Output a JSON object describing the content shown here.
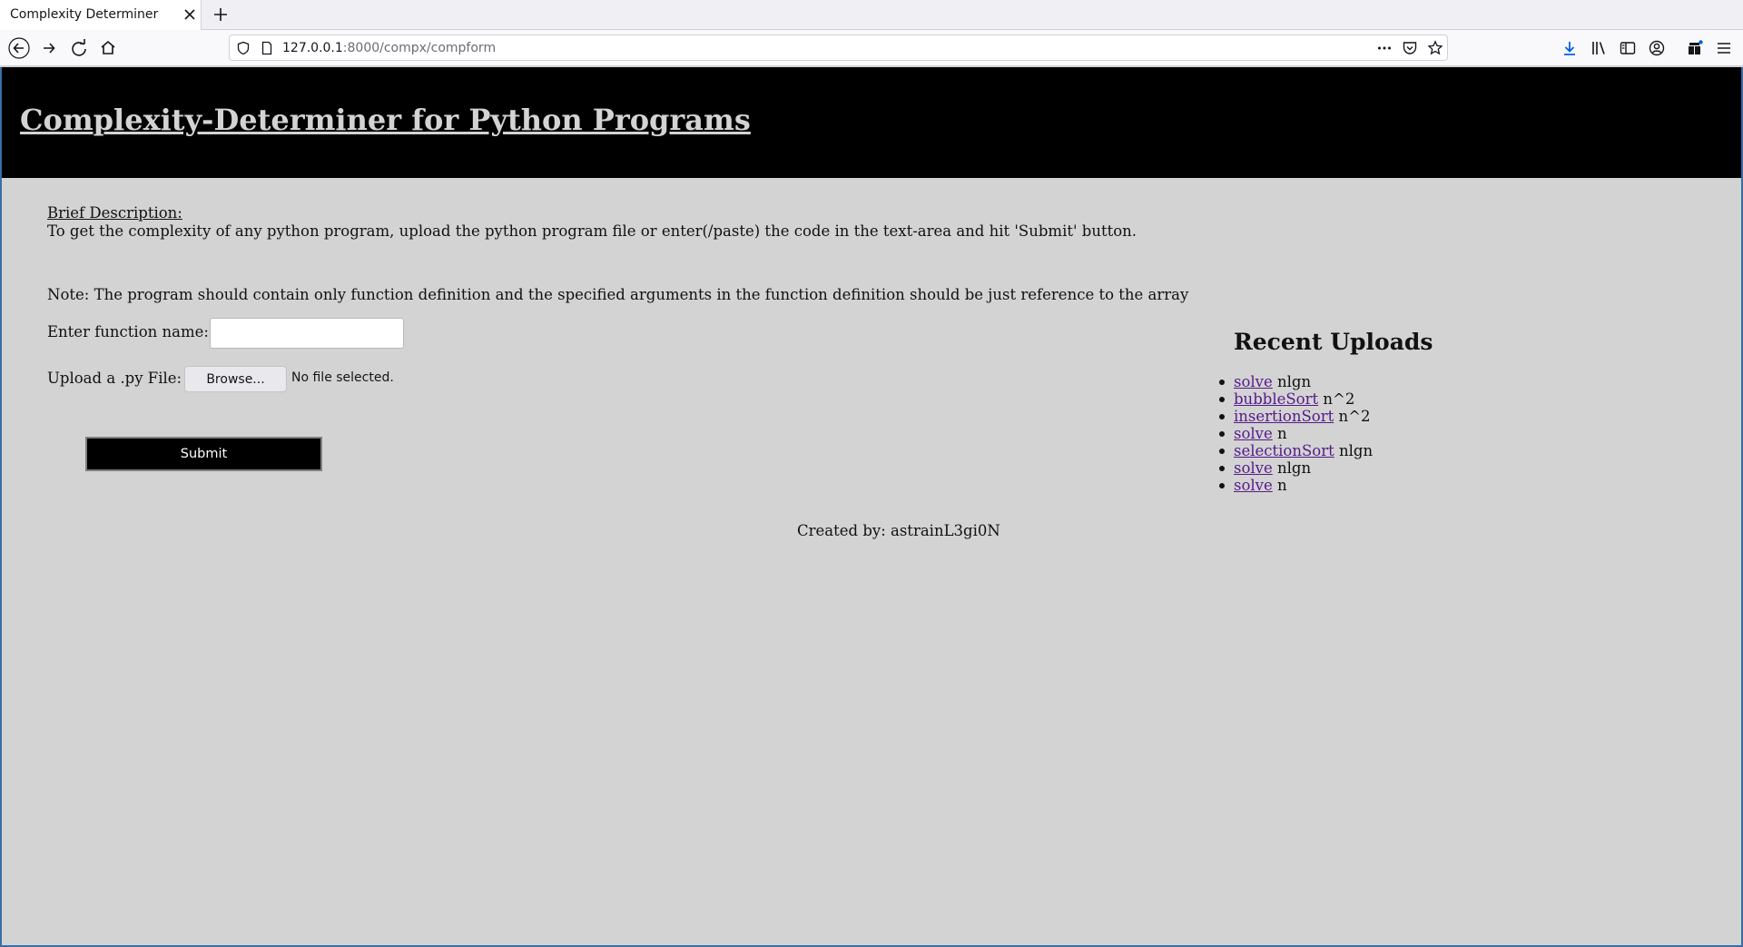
{
  "browser": {
    "tab_title": "Complexity Determiner",
    "url_host": "127.0.0.1",
    "url_rest": ":8000/compx/compform"
  },
  "header": {
    "title": "Complexity-Determiner for Python Programs"
  },
  "description": {
    "heading": "Brief Description:",
    "text": "To get the complexity of any python program, upload the python program file or enter(/paste) the code in the text-area and hit 'Submit' button.",
    "note": "Note: The program should contain only function definition and the specified arguments in the function definition should be just reference to the array"
  },
  "form": {
    "function_label": "Enter function name:",
    "function_value": "",
    "upload_label": "Upload a .py File:",
    "browse_label": "Browse...",
    "no_file_text": "No file selected.",
    "submit_label": "Submit"
  },
  "recent_uploads": {
    "title": "Recent Uploads",
    "items": [
      {
        "name": "solve",
        "complexity": "nlgn"
      },
      {
        "name": "bubbleSort",
        "complexity": "n^2"
      },
      {
        "name": "insertionSort",
        "complexity": "n^2"
      },
      {
        "name": "solve",
        "complexity": "n"
      },
      {
        "name": "selectionSort",
        "complexity": "nlgn"
      },
      {
        "name": "solve",
        "complexity": "nlgn"
      },
      {
        "name": "solve",
        "complexity": "n"
      }
    ]
  },
  "footer": {
    "text": "Created by: astrainL3gi0N"
  },
  "colors": {
    "header_bg": "#000000",
    "page_bg": "#d3d3d3",
    "visited_link": "#551a8b",
    "download_accent": "#0060df"
  },
  "icons": {
    "tab_close": "close-icon",
    "new_tab": "plus-icon",
    "back": "back-arrow-icon",
    "forward": "forward-arrow-icon",
    "reload": "reload-icon",
    "home": "home-icon",
    "shield": "shield-icon",
    "page": "page-icon",
    "more": "ellipsis-icon",
    "pocket": "pocket-icon",
    "bookmark": "star-icon",
    "downloads": "download-icon",
    "library": "library-icon",
    "sidebar": "sidebar-icon",
    "account": "account-icon",
    "extensions": "extensions-icon",
    "menu": "hamburger-menu-icon"
  }
}
